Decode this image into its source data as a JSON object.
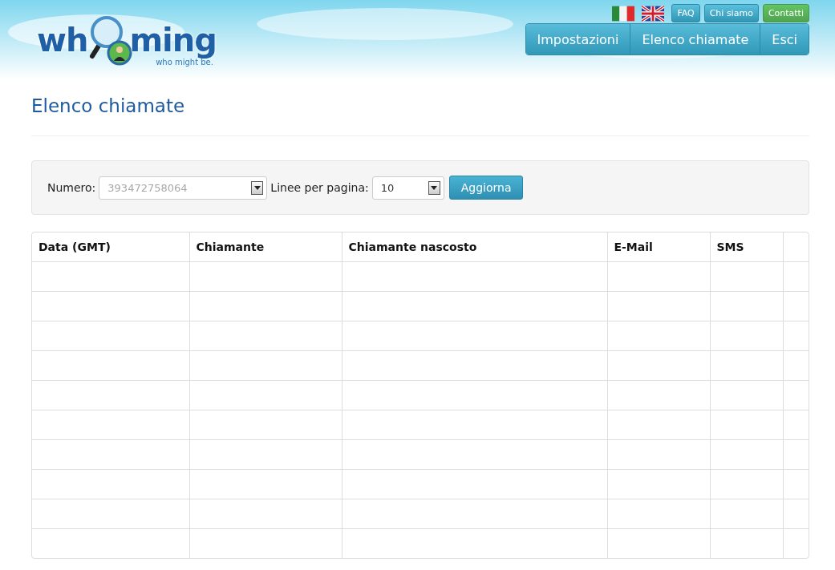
{
  "logo": {
    "parts": [
      "wh",
      "ming"
    ],
    "tagline": "who might be."
  },
  "top_links": [
    {
      "label": "FAQ",
      "kind": "info"
    },
    {
      "label": "Chi siamo",
      "kind": "info"
    },
    {
      "label": "Contatti",
      "kind": "success"
    }
  ],
  "nav": [
    {
      "label": "Impostazioni"
    },
    {
      "label": "Elenco chiamate"
    },
    {
      "label": "Esci"
    }
  ],
  "page_title": "Elenco chiamate",
  "filter": {
    "number_label": "Numero:",
    "number_value": "393472758064",
    "lines_label": "Linee per pagina:",
    "lines_value": "10",
    "button": "Aggiorna"
  },
  "table": {
    "columns": [
      "Data (GMT)",
      "Chiamante",
      "Chiamante nascosto",
      "E-Mail",
      "SMS"
    ]
  }
}
